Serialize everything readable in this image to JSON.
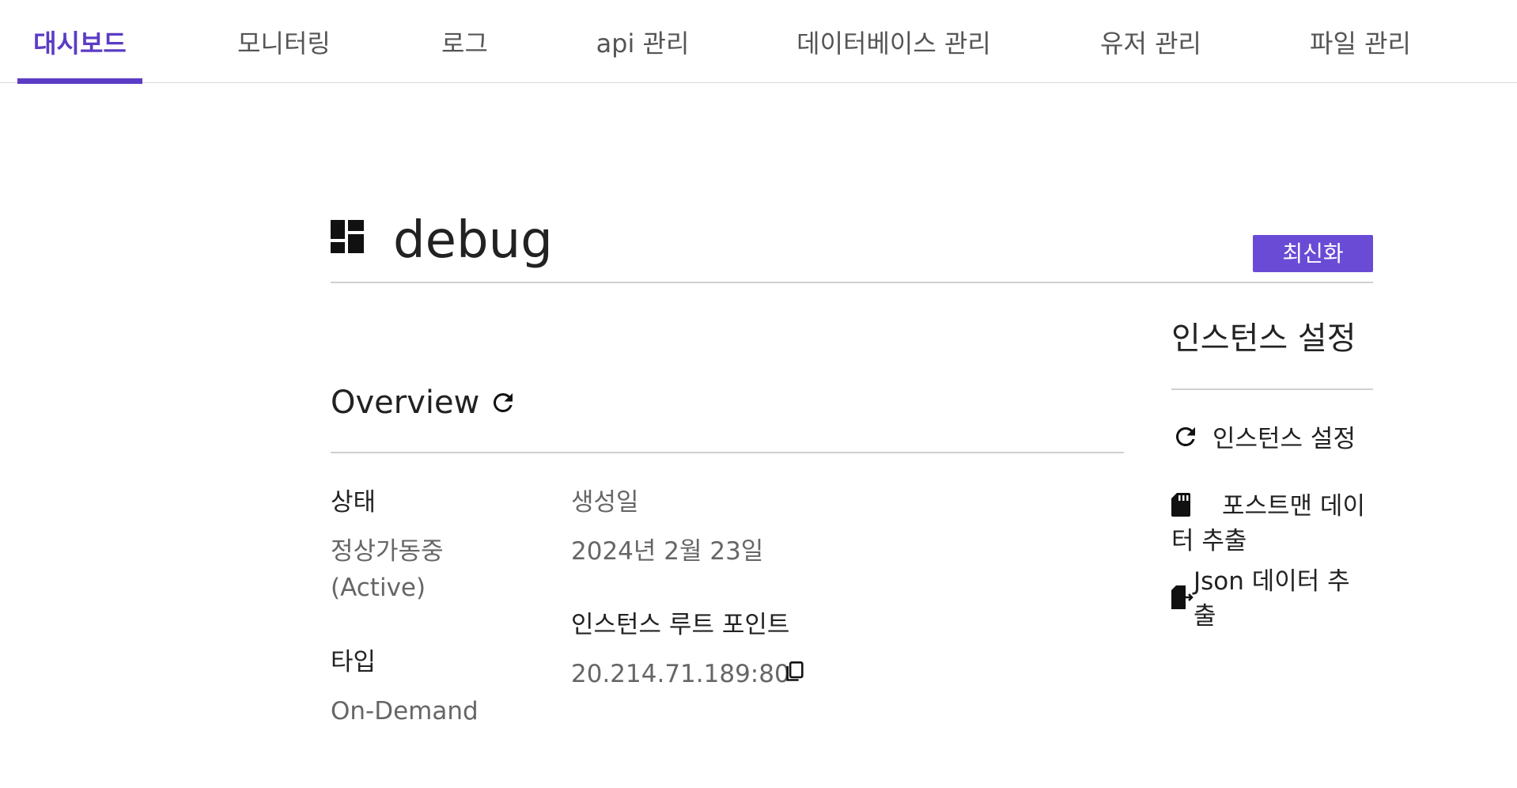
{
  "tabs": [
    {
      "label": "대시보드",
      "active": true
    },
    {
      "label": "모니터링",
      "active": false
    },
    {
      "label": "로그",
      "active": false
    },
    {
      "label": "api 관리",
      "active": false
    },
    {
      "label": "데이터베이스 관리",
      "active": false
    },
    {
      "label": "유저 관리",
      "active": false
    },
    {
      "label": "파일 관리",
      "active": false
    }
  ],
  "header": {
    "icon": "dashboard-icon",
    "title": "debug",
    "refresh_label": "최신화"
  },
  "overview": {
    "title": "Overview",
    "refresh_icon": "refresh-icon",
    "status_label": "상태",
    "status_value_line1": "정상가동중",
    "status_value_line2": "(Active)",
    "type_label": "타입",
    "type_value": "On-Demand",
    "created_label": "생성일",
    "created_value": "2024년 2월 23일",
    "endpoint_label": "인스턴스 루트 포인트",
    "endpoint_value": "20.214.71.189:80",
    "copy_icon": "copy-icon"
  },
  "side_panel": {
    "title": "인스턴스 설정",
    "items": [
      {
        "icon": "refresh-icon",
        "label": "인스턴스 설정"
      },
      {
        "icon": "sd-card-icon",
        "label_line1": "포스트맨 데이",
        "label_line2": "터 추출"
      },
      {
        "icon": "file-export-icon",
        "label_line1": "Json 데이터 추",
        "label_line2": "출"
      }
    ]
  },
  "colors": {
    "accent": "#5b3cc4",
    "button": "#6a4bd6",
    "text": "#222222",
    "muted": "#666666",
    "divider": "#d0d0d0"
  }
}
